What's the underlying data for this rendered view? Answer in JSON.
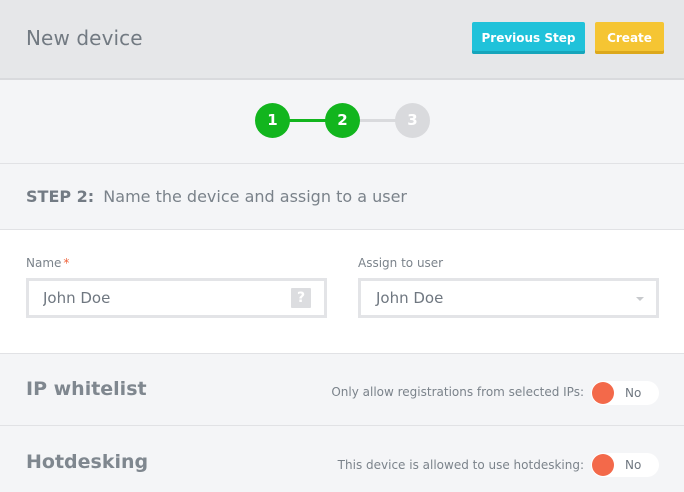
{
  "header": {
    "title": "New device",
    "previous_label": "Previous Step",
    "create_label": "Create"
  },
  "stepper": {
    "steps": [
      "1",
      "2",
      "3"
    ],
    "current": 2
  },
  "step_heading": {
    "label": "STEP 2:",
    "text": "Name the device and assign to a user"
  },
  "form": {
    "name_label": "Name",
    "required_mark": "*",
    "name_value": "John Doe",
    "help_glyph": "?",
    "assign_label": "Assign to user",
    "assign_value": "John Doe"
  },
  "ip_whitelist": {
    "title": "IP whitelist",
    "description": "Only allow registrations from selected IPs:",
    "toggle_text": "No"
  },
  "hotdesking": {
    "title": "Hotdesking",
    "description": "This device is allowed to use hotdesking:",
    "toggle_text": "No"
  },
  "colors": {
    "accent_cyan": "#20c2da",
    "accent_yellow": "#f5c533",
    "step_active": "#12b51e",
    "step_inactive": "#d9dadd",
    "toggle_off": "#f3694a"
  },
  "icons": {
    "help": "question-mark-icon",
    "select": "chevron-down-icon"
  }
}
